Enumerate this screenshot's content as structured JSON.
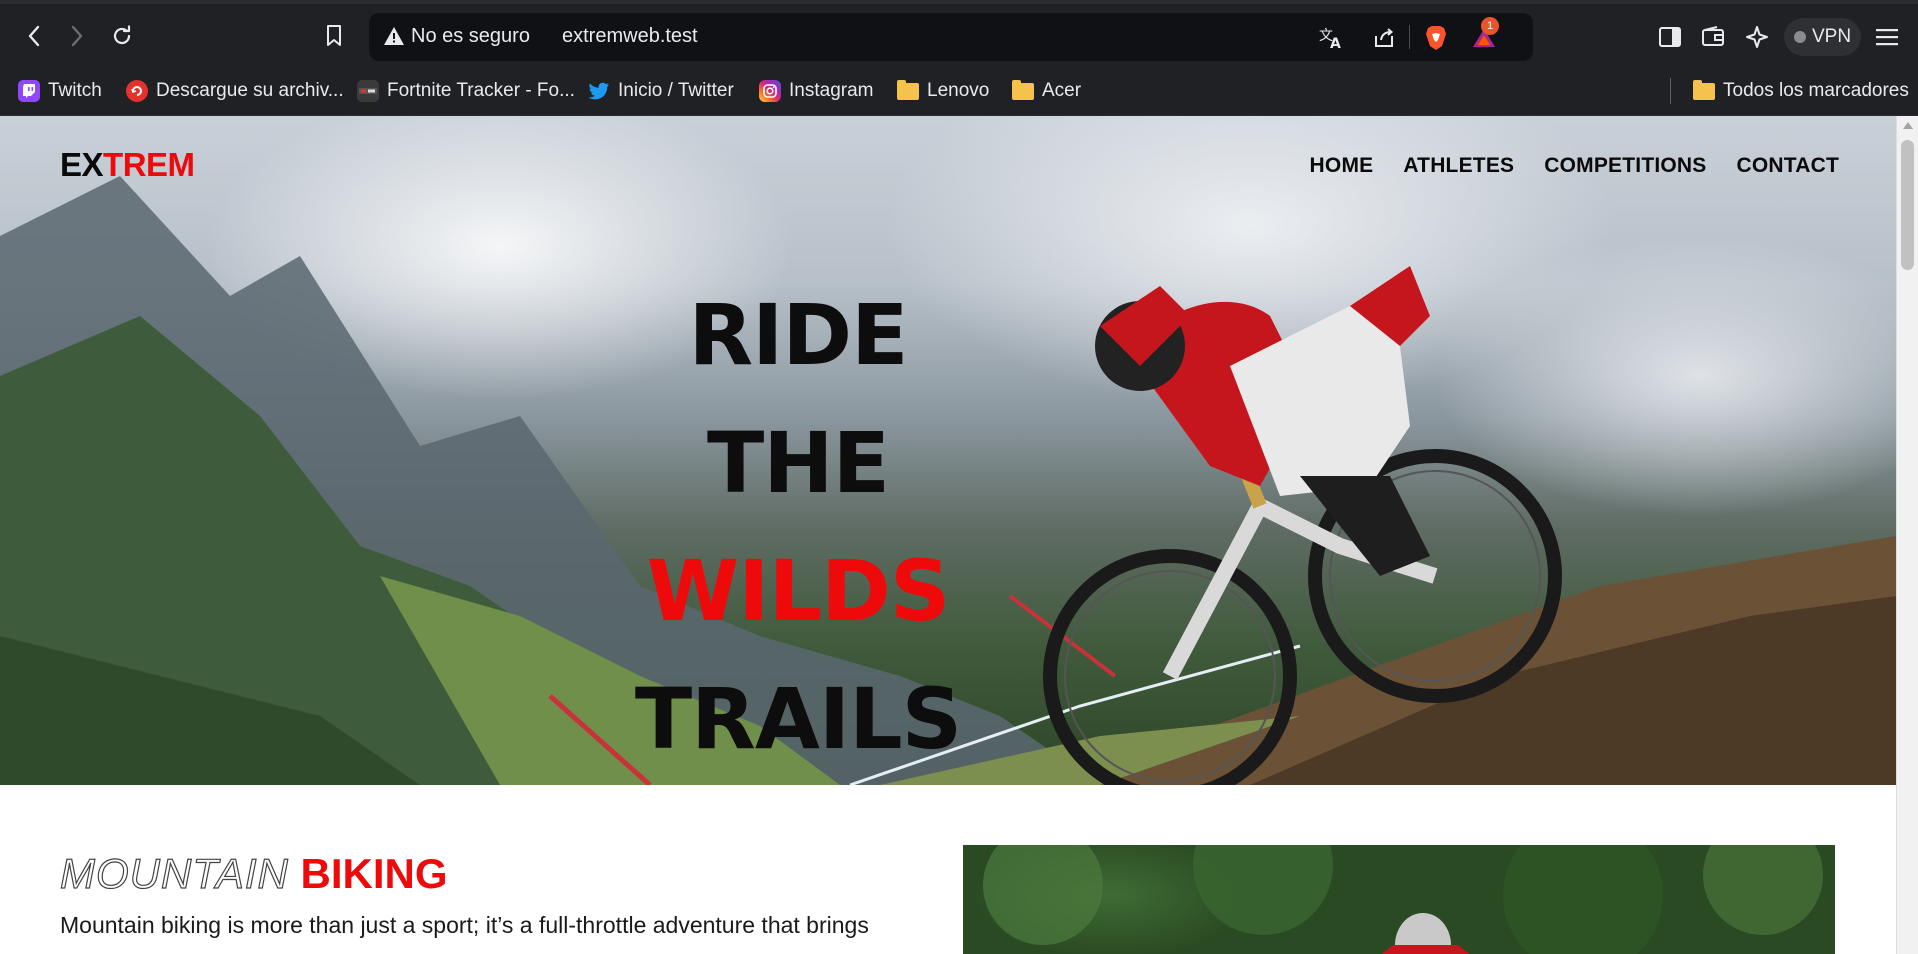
{
  "browser": {
    "security_label": "No es seguro",
    "url": "extremweb.test",
    "notification_count": "1",
    "vpn_label": "VPN"
  },
  "bookmarks": [
    {
      "label": "Twitch",
      "icon": "twitch-icon",
      "color": "#9146ff"
    },
    {
      "label": "Descargue su archiv...",
      "icon": "download-site-icon",
      "color": "#e5322d"
    },
    {
      "label": "Fortnite Tracker - Fo...",
      "icon": "fortnite-tracker-icon",
      "color": "#3a3a3a"
    },
    {
      "label": "Inicio / Twitter",
      "icon": "twitter-icon",
      "color": "#1d9bf0"
    },
    {
      "label": "Instagram",
      "icon": "instagram-icon",
      "color": "#d6249f"
    },
    {
      "label": "Lenovo",
      "icon": "folder-icon",
      "color": "#f5c24c"
    },
    {
      "label": "Acer",
      "icon": "folder-icon",
      "color": "#f5c24c"
    }
  ],
  "all_bookmarks_label": "Todos los marcadores",
  "site": {
    "logo_part1": "EX",
    "logo_part2": "TREM",
    "nav": [
      "HOME",
      "ATHLETES",
      "COMPETITIONS",
      "CONTACT"
    ],
    "headline_line1": "RIDE",
    "headline_line2_a": "THE ",
    "headline_line2_b": "WILDS",
    "headline_line3": "TRAILS",
    "section_title_outline": "MOUNTAIN",
    "section_title_red": "BIKING",
    "section_text": "Mountain biking is more than just a sport; it’s a full-throttle adventure that brings riders face to face with nature, demands skill and nerve."
  },
  "colors": {
    "accent_red": "#ee0a0a",
    "browser_bg": "#202124"
  }
}
